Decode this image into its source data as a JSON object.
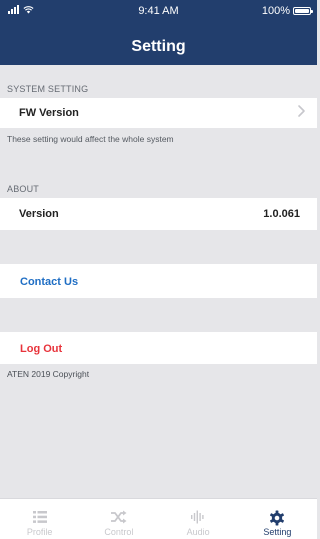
{
  "status_bar": {
    "time": "9:41 AM",
    "battery": "100%"
  },
  "header": {
    "title": "Setting"
  },
  "system_setting": {
    "section_label": "SYSTEM SETTING",
    "fw_version_label": "FW Version",
    "description": "These setting would affect the whole system"
  },
  "about": {
    "section_label": "ABOUT",
    "version_label": "Version",
    "version_value": "1.0.061"
  },
  "actions": {
    "contact_label": "Contact Us",
    "logout_label": "Log Out"
  },
  "footer": {
    "copyright": "ATEN 2019 Copyright"
  },
  "tabbar": {
    "tabs": [
      {
        "label": "Profile",
        "icon": "list-icon"
      },
      {
        "label": "Control",
        "icon": "shuffle-icon"
      },
      {
        "label": "Audio",
        "icon": "audio-wave-icon"
      },
      {
        "label": "Setting",
        "icon": "gear-icon"
      }
    ],
    "active_index": 3
  },
  "colors": {
    "header_bg": "#223e6d",
    "contact": "#1f6ec4",
    "logout": "#e8333b",
    "inactive_tab": "#c8c8cc"
  }
}
